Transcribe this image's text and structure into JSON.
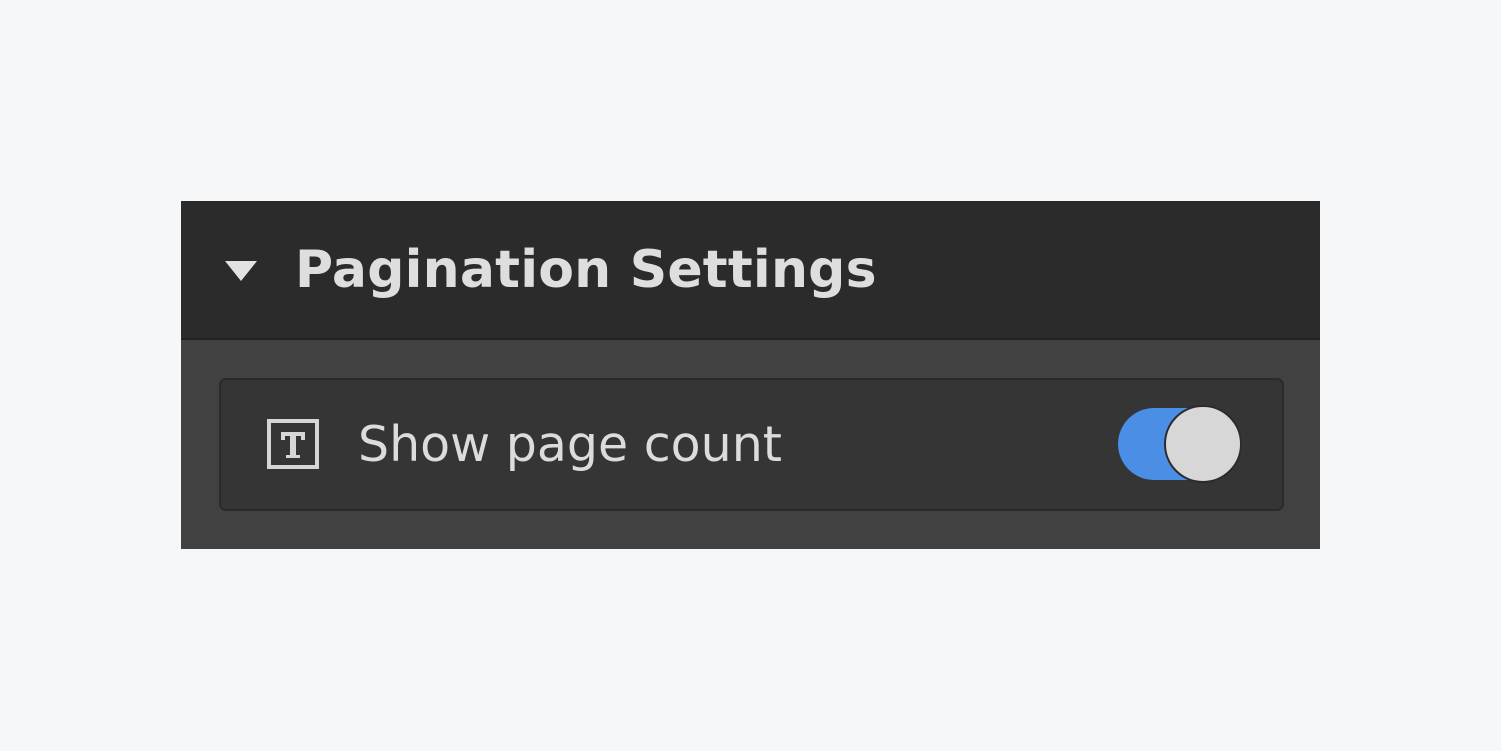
{
  "panel": {
    "title": "Pagination Settings",
    "expanded": true,
    "header_icon": "caret-down-icon"
  },
  "settings": [
    {
      "icon": "text-icon",
      "label": "Show page count",
      "toggle_on": true
    }
  ],
  "colors": {
    "background": "#f6f7f9",
    "header_bg": "#2b2b2b",
    "panel_bg": "#414141",
    "row_bg": "#353535",
    "text": "#dcdcdc",
    "toggle_on": "#4a8ee6",
    "toggle_knob": "#d7d7d7"
  }
}
